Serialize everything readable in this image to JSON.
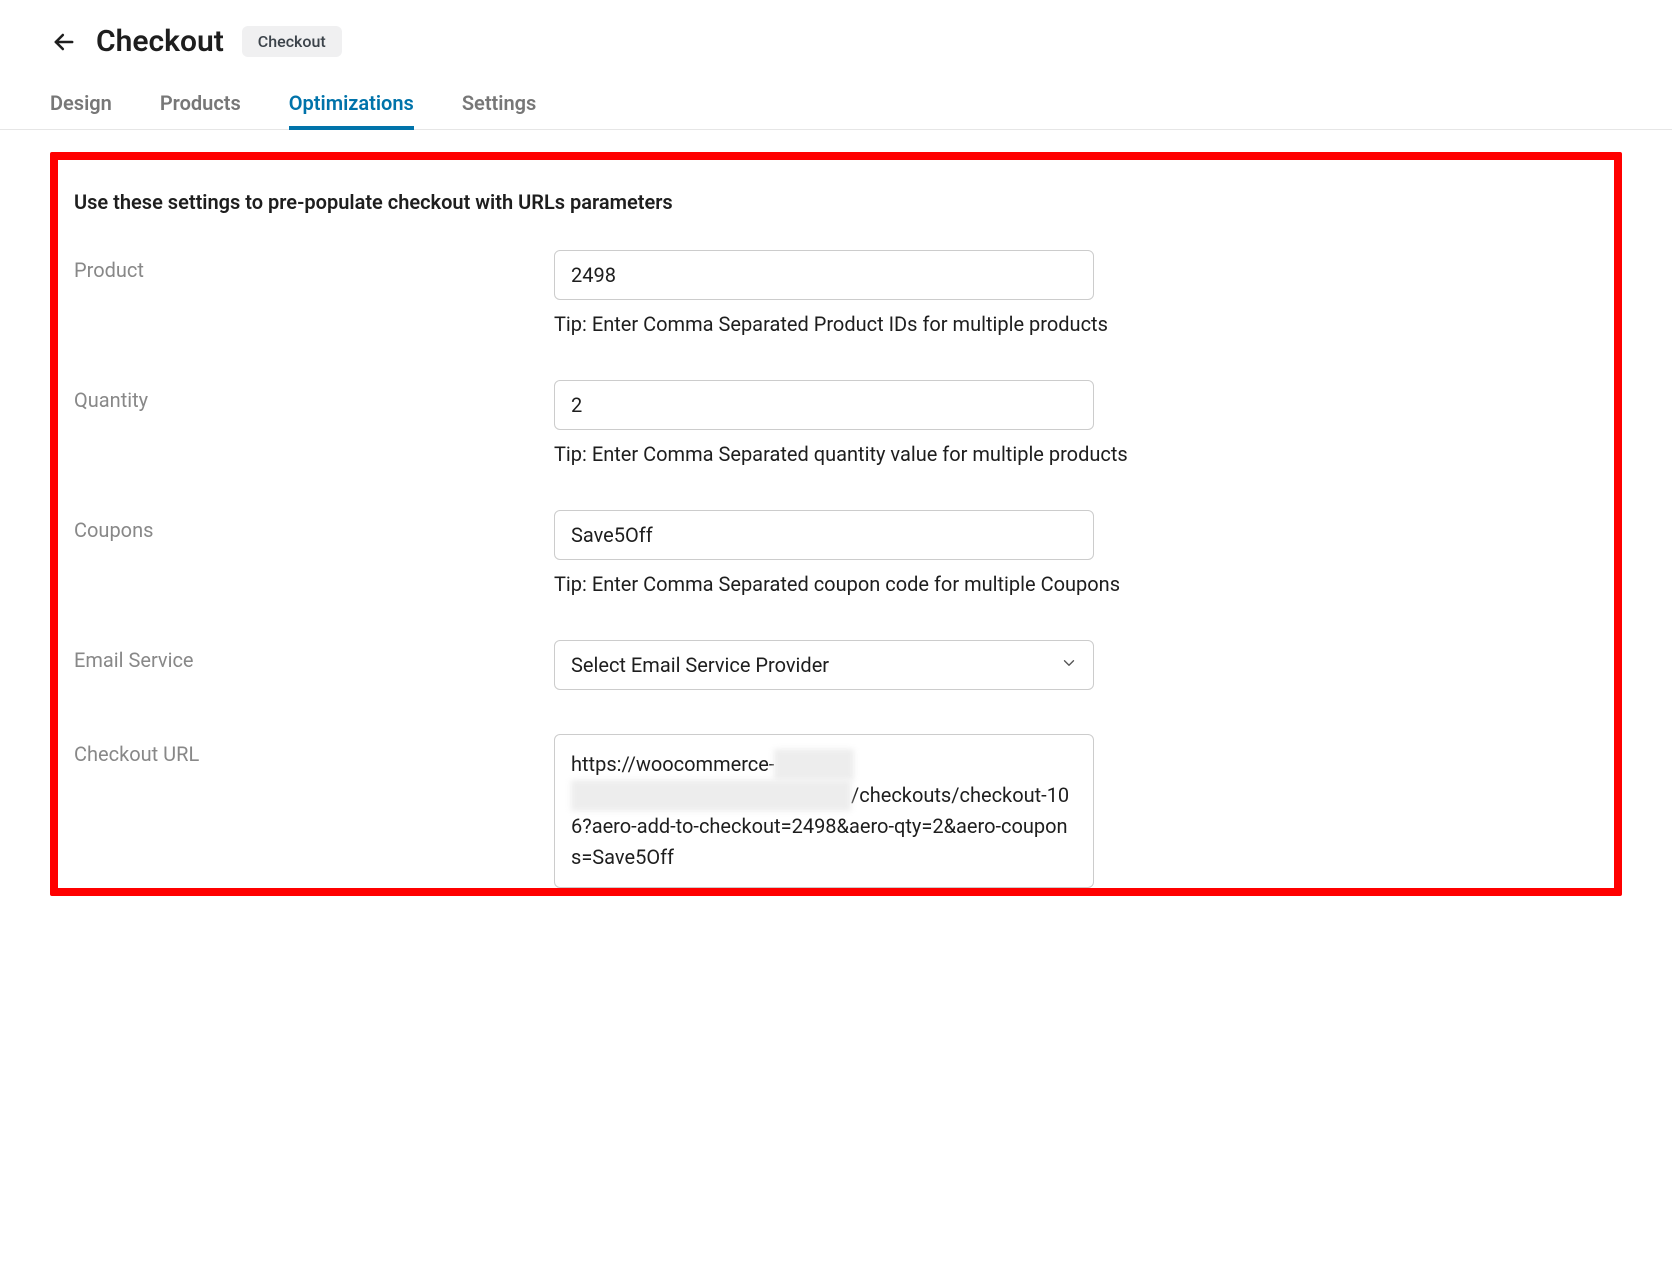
{
  "header": {
    "title": "Checkout",
    "pill": "Checkout"
  },
  "tabs": {
    "design": "Design",
    "products": "Products",
    "optimizations": "Optimizations",
    "settings": "Settings"
  },
  "section": {
    "description": "Use these settings to pre-populate checkout with URLs parameters"
  },
  "fields": {
    "product": {
      "label": "Product",
      "value": "2498",
      "tip": "Tip: Enter Comma Separated Product IDs for multiple products"
    },
    "quantity": {
      "label": "Quantity",
      "value": "2",
      "tip": "Tip: Enter Comma Separated quantity value for multiple products"
    },
    "coupons": {
      "label": "Coupons",
      "value": "Save5Off",
      "tip": "Tip: Enter Comma Separated coupon code for multiple Coupons"
    },
    "email_service": {
      "label": "Email Service",
      "placeholder": "Select Email Service Provider"
    },
    "checkout_url": {
      "label": "Checkout URL",
      "prefix": "https://woocommerce-",
      "hidden1": "xxxxxx",
      "hidden2": "xxxxxxxxxxxxxxxxxxxxxxxxxxx",
      "suffix": "/checkouts/checkout-106?aero-add-to-checkout=2498&aero-qty=2&aero-coupons=Save5Off"
    }
  }
}
